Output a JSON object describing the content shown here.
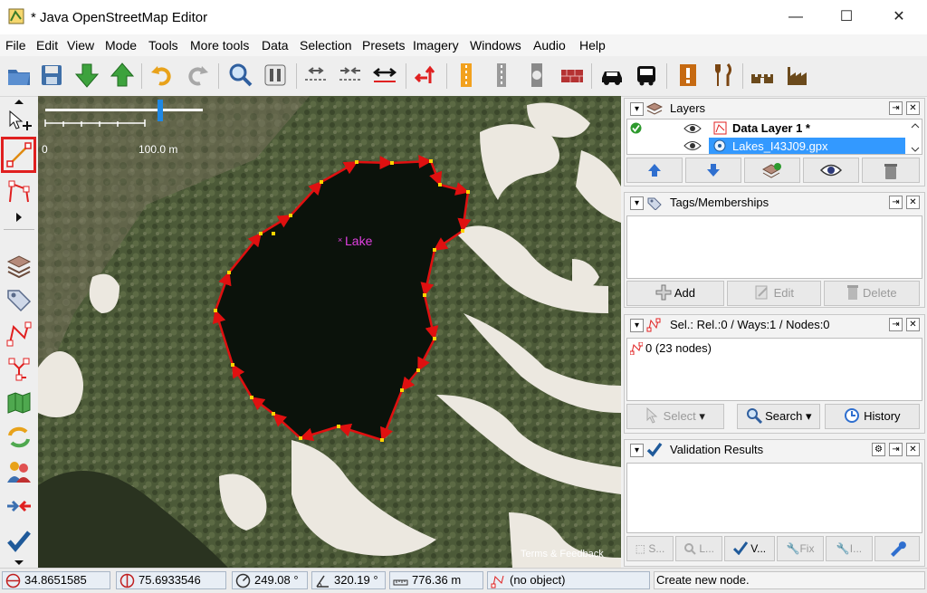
{
  "window": {
    "title": "* Java OpenStreetMap Editor",
    "minimize_glyph": "—",
    "maximize_glyph": "☐",
    "close_glyph": "✕"
  },
  "menu": [
    "File",
    "Edit",
    "View",
    "Mode",
    "Tools",
    "More tools",
    "Data",
    "Selection",
    "Presets",
    "Imagery",
    "Windows",
    "Audio",
    "Help"
  ],
  "map": {
    "scale_zero": "0",
    "scale_label": "100.0 m",
    "object_label": "Lake",
    "attribution": "Terms & Feedback"
  },
  "layers_panel": {
    "title": "Layers",
    "layers": [
      {
        "name": "Data Layer 1 *",
        "bold": true,
        "selected": false
      },
      {
        "name": "Lakes_I43J09.gpx",
        "bold": false,
        "selected": true
      }
    ]
  },
  "tags_panel": {
    "title": "Tags/Memberships",
    "buttons": {
      "add": "Add",
      "edit": "Edit",
      "delete": "Delete"
    }
  },
  "selection_panel": {
    "title": "Sel.: Rel.:0 / Ways:1 / Nodes:0",
    "items": [
      "0 (23 nodes)"
    ],
    "buttons": {
      "select": "Select",
      "search": "Search",
      "history": "History"
    }
  },
  "validation_panel": {
    "title": "Validation Results",
    "buttons": [
      "S...",
      "L...",
      "V...",
      "Fix",
      "I..."
    ]
  },
  "status": {
    "lat": "34.8651585",
    "lon": "75.6933546",
    "heading": "249.08 °",
    "angle": "320.19 °",
    "distance": "776.36 m",
    "object": "(no object)",
    "message": "Create new node."
  },
  "colors": {
    "accent_selected": "#3399ff",
    "way_red": "#e01010",
    "node_yellow": "#ffd400",
    "label_magenta": "#e040e0",
    "highlight_box": "#e02020"
  }
}
